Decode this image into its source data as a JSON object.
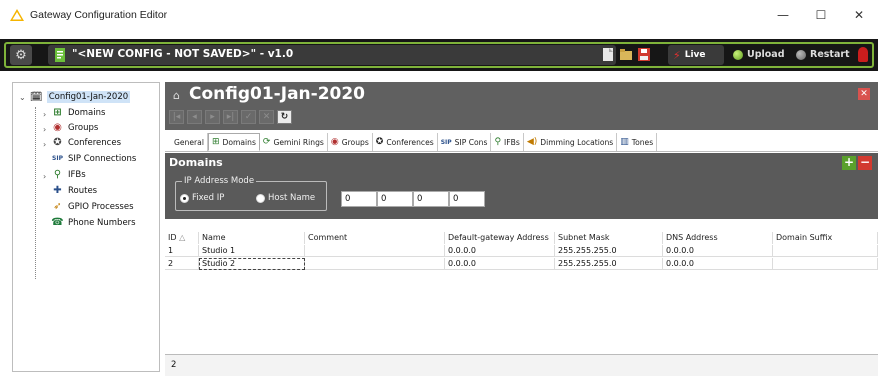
{
  "window": {
    "title": "Gateway Configuration Editor",
    "minimize": "—",
    "maximize": "☐",
    "close": "✕"
  },
  "toolbar": {
    "config_name": "\"<NEW CONFIG - NOT SAVED>\" - v1.0",
    "live_label": "Live",
    "upload_label": "Upload",
    "restart_label": "Restart",
    "accent_green": "#7fb33a"
  },
  "tree": {
    "root": "Config01-Jan-2020",
    "items": [
      {
        "label": "Domains",
        "icon": "domains-icon"
      },
      {
        "label": "Groups",
        "icon": "groups-icon"
      },
      {
        "label": "Conferences",
        "icon": "conferences-icon"
      },
      {
        "label": "SIP Connections",
        "icon": "sip-icon"
      },
      {
        "label": "IFBs",
        "icon": "ifb-icon"
      },
      {
        "label": "Routes",
        "icon": "routes-icon"
      },
      {
        "label": "GPIO Processes",
        "icon": "gpio-icon"
      },
      {
        "label": "Phone Numbers",
        "icon": "phone-icon"
      }
    ]
  },
  "main": {
    "title": "Config01-Jan-2020",
    "tabs": [
      {
        "label": "General"
      },
      {
        "label": "Domains"
      },
      {
        "label": "Gemini Rings"
      },
      {
        "label": "Groups"
      },
      {
        "label": "Conferences"
      },
      {
        "label": "SIP Cons"
      },
      {
        "label": "IFBs"
      },
      {
        "label": "Dimming Locations"
      },
      {
        "label": "Tones"
      }
    ],
    "section_title": "Domains",
    "ip_mode": {
      "legend": "IP Address Mode",
      "fixed_ip": "Fixed IP",
      "host_name": "Host Name",
      "selected": "Fixed IP",
      "octets": [
        "0",
        "0",
        "0",
        "0"
      ]
    },
    "table": {
      "columns": [
        "ID",
        "Name",
        "Comment",
        "Default-gateway Address",
        "Subnet Mask",
        "DNS Address",
        "Domain Suffix"
      ],
      "rows": [
        {
          "id": "1",
          "name": "Studio 1",
          "comment": "",
          "gateway": "0.0.0.0",
          "subnet": "255.255.255.0",
          "dns": "0.0.0.0",
          "suffix": ""
        },
        {
          "id": "2",
          "name": "Studio 2",
          "comment": "",
          "gateway": "0.0.0.0",
          "subnet": "255.255.255.0",
          "dns": "0.0.0.0",
          "suffix": ""
        }
      ],
      "row_count": "2"
    }
  }
}
